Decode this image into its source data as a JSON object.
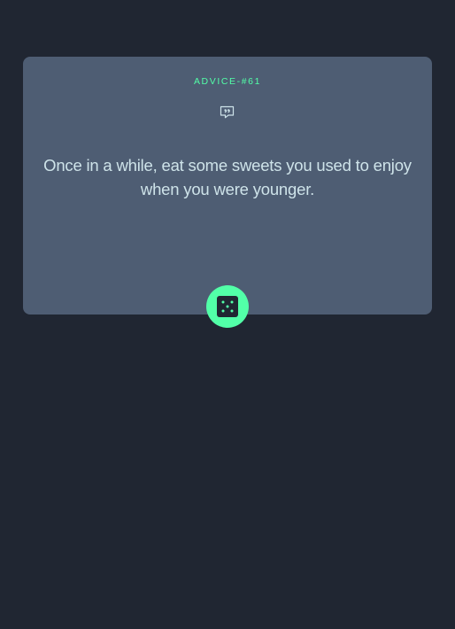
{
  "advice": {
    "id_label": "ADVICE-#61",
    "text": "Once in a while, eat some sweets you used to enjoy when you were younger."
  },
  "icons": {
    "quote": "quote-speech-bubble-icon",
    "dice": "dice-icon"
  },
  "colors": {
    "page_background": "#202632",
    "card_background": "#4e5d73",
    "accent": "#52ffa8",
    "text": "#cee3e9"
  }
}
